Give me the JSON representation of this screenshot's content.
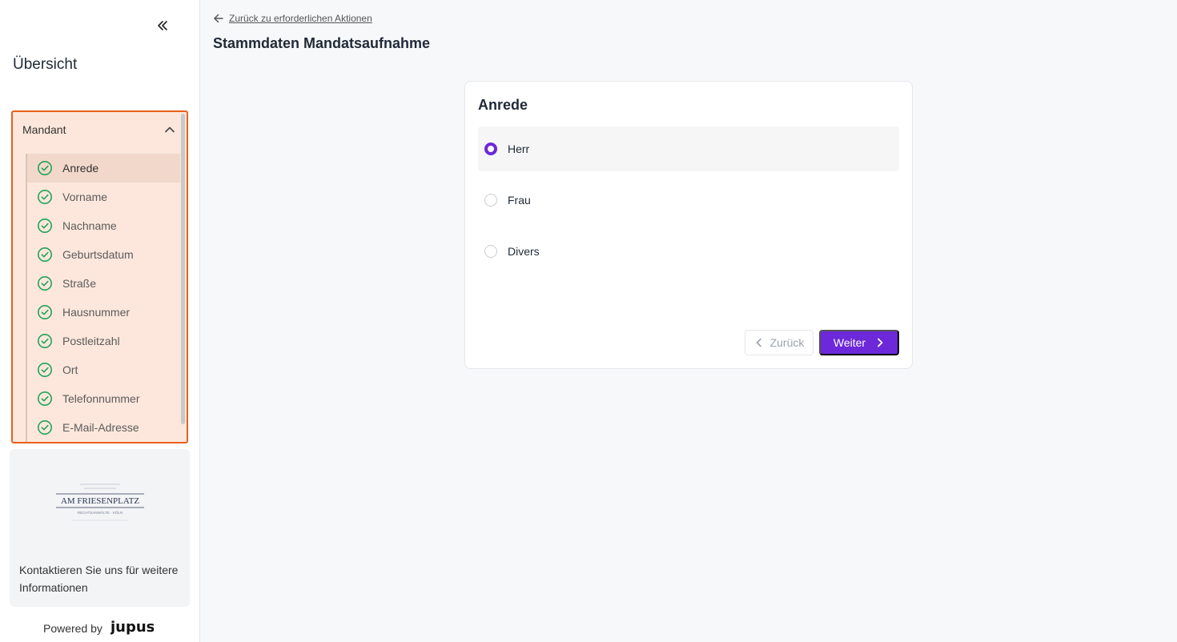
{
  "sidebar": {
    "overview_title": "Übersicht",
    "section": {
      "label": "Mandant",
      "items": [
        {
          "label": "Anrede",
          "active": true
        },
        {
          "label": "Vorname"
        },
        {
          "label": "Nachname"
        },
        {
          "label": "Geburtsdatum"
        },
        {
          "label": "Straße"
        },
        {
          "label": "Hausnummer"
        },
        {
          "label": "Postleitzahl"
        },
        {
          "label": "Ort"
        },
        {
          "label": "Telefonnummer"
        },
        {
          "label": "E-Mail-Adresse"
        }
      ]
    },
    "contact": {
      "logo_text": "AM FRIESENPLATZ",
      "logo_subtext": "RECHTSANWÄLTE · KÖLN",
      "text": "Kontaktieren Sie uns für weitere Informationen"
    },
    "powered_by": "Powered by",
    "powered_brand": "jupus"
  },
  "main": {
    "back_link": "Zurück zu erforderlichen Aktionen",
    "page_title": "Stammdaten Mandatsaufnahme",
    "card": {
      "title": "Anrede",
      "options": [
        {
          "label": "Herr",
          "selected": true
        },
        {
          "label": "Frau"
        },
        {
          "label": "Divers"
        }
      ],
      "prev_label": "Zurück",
      "next_label": "Weiter"
    }
  },
  "colors": {
    "accent": "#6d28d9",
    "section_border": "#e8611a",
    "section_bg": "#fde7dc",
    "check_green": "#22a35a"
  },
  "icons": [
    "chevrons-left-icon",
    "chevron-up-icon",
    "check-circle-icon",
    "arrow-left-icon",
    "chevron-left-icon",
    "chevron-right-icon"
  ]
}
